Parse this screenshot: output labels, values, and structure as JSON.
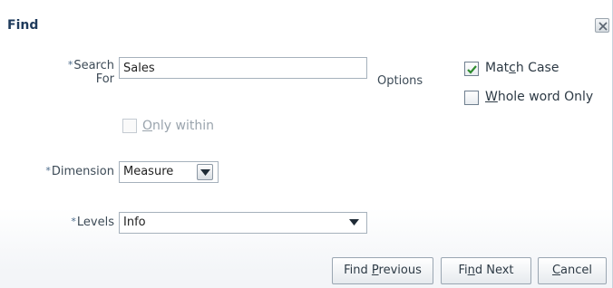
{
  "dialog": {
    "title": "Find"
  },
  "search": {
    "required_mark": "*",
    "label_line1": "Search",
    "label_line2": "For",
    "value": "Sales",
    "only_within_label": "Only within",
    "only_within_mnemonic": "O",
    "only_within_rest": "nly within",
    "only_within_checked": false
  },
  "options": {
    "label": "Options",
    "match_case": {
      "pre": "Mat",
      "mnemonic": "c",
      "post": "h Case",
      "checked": true
    },
    "whole_word": {
      "pre": "",
      "mnemonic": "W",
      "post": "hole word Only",
      "checked": false
    }
  },
  "dimension": {
    "required_mark": "*",
    "label": "Dimension",
    "value": "Measure"
  },
  "levels": {
    "required_mark": "*",
    "label": "Levels",
    "value": "Info"
  },
  "buttons": {
    "find_previous": {
      "pre": "Find ",
      "mnemonic": "P",
      "post": "revious"
    },
    "find_next": {
      "pre": "Fi",
      "mnemonic": "n",
      "post": "d Next"
    },
    "cancel": {
      "pre": "",
      "mnemonic": "C",
      "post": "ancel"
    }
  },
  "icons": {
    "close": "close-icon",
    "checkmark": "checkmark-icon",
    "dropdown": "chevron-down-icon"
  },
  "colors": {
    "title": "#1f3b5c",
    "checkmark": "#2e8b2e",
    "label": "#3d4b57"
  }
}
